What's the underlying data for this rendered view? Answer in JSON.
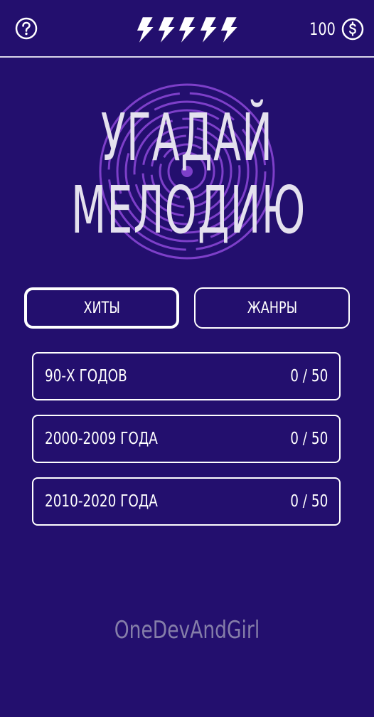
{
  "header": {
    "help_icon": "question-circle-icon",
    "energy_icon": "lightning-bolt-icon",
    "energy_count": 5,
    "coins": "100",
    "coin_icon": "dollar-circle-icon"
  },
  "logo": {
    "line1": "УГАДАЙ",
    "line2": "МЕЛОДИЮ",
    "background_icon": "vinyl-record-icon"
  },
  "tabs": [
    {
      "label": "ХИТЫ",
      "active": true
    },
    {
      "label": "ЖАНРЫ",
      "active": false
    }
  ],
  "categories": [
    {
      "label": "90-Х ГОДОВ",
      "progress": "0 / 50"
    },
    {
      "label": "2000-2009 ГОДА",
      "progress": "0 / 50"
    },
    {
      "label": "2010-2020 ГОДА",
      "progress": "0 / 50"
    }
  ],
  "footer": {
    "developer": "OneDevAndGirl"
  },
  "colors": {
    "background": "#230f6e",
    "accent_ring": "#7d3fc9",
    "text": "#ffffff",
    "footer_text": "#857ea9"
  }
}
